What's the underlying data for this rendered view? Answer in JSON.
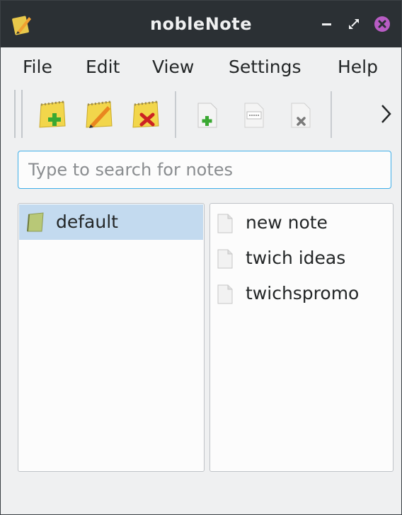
{
  "window": {
    "title": "nobleNote",
    "app_icon": "notepad-pencil-icon",
    "controls": [
      "minimize-icon",
      "maximize-icon",
      "close-icon"
    ],
    "colors": {
      "titlebar": "#2b3034",
      "close": "#b85cc4",
      "accent": "#3daee9",
      "selection": "#c3daef"
    }
  },
  "menubar": {
    "items": [
      {
        "label": "File"
      },
      {
        "label": "Edit"
      },
      {
        "label": "View"
      },
      {
        "label": "Settings"
      },
      {
        "label": "Help"
      }
    ]
  },
  "toolbar": {
    "buttons": [
      {
        "icon": "new-folder-icon"
      },
      {
        "icon": "rename-folder-icon"
      },
      {
        "icon": "delete-folder-icon"
      },
      {
        "icon": "new-note-icon"
      },
      {
        "icon": "rename-note-icon"
      },
      {
        "icon": "delete-note-icon"
      }
    ],
    "overflow_icon": "chevron-right-icon"
  },
  "search": {
    "placeholder": "Type to search for notes",
    "value": ""
  },
  "folders": {
    "items": [
      {
        "label": "default",
        "selected": true
      }
    ]
  },
  "notes": {
    "items": [
      {
        "label": "new note"
      },
      {
        "label": "twich ideas"
      },
      {
        "label": "twichspromo"
      }
    ]
  }
}
